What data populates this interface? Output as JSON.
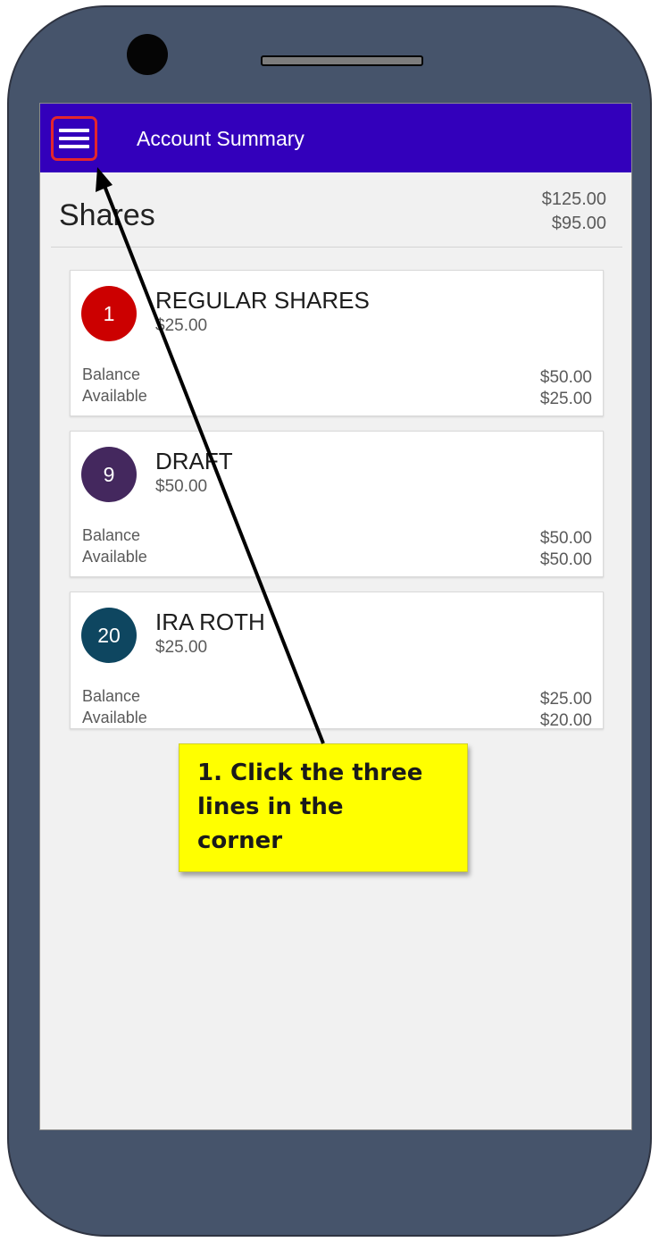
{
  "app_bar": {
    "title": "Account Summary",
    "menu_icon": "hamburger-menu-icon",
    "background": "#3300bb"
  },
  "section": {
    "title": "Shares",
    "totals": [
      "$125.00",
      "$95.00"
    ]
  },
  "accounts": [
    {
      "badge": "1",
      "badge_color": "#cc0000",
      "name": "REGULAR SHARES",
      "amount": "$25.00",
      "labels": [
        "Balance",
        "Available"
      ],
      "values": [
        "$50.00",
        "$25.00"
      ]
    },
    {
      "badge": "9",
      "badge_color": "#44285e",
      "name": "DRAFT",
      "amount": "$50.00",
      "labels": [
        "Balance",
        "Available"
      ],
      "values": [
        "$50.00",
        "$50.00"
      ]
    },
    {
      "badge": "20",
      "badge_color": "#0e4660",
      "name": "IRA ROTH",
      "amount": "$25.00",
      "labels": [
        "Balance",
        "Available"
      ],
      "values": [
        "$25.00",
        "$20.00"
      ]
    }
  ],
  "callout": {
    "text": "1. Click the three\nlines in the\ncorner",
    "background": "#ffff00"
  }
}
